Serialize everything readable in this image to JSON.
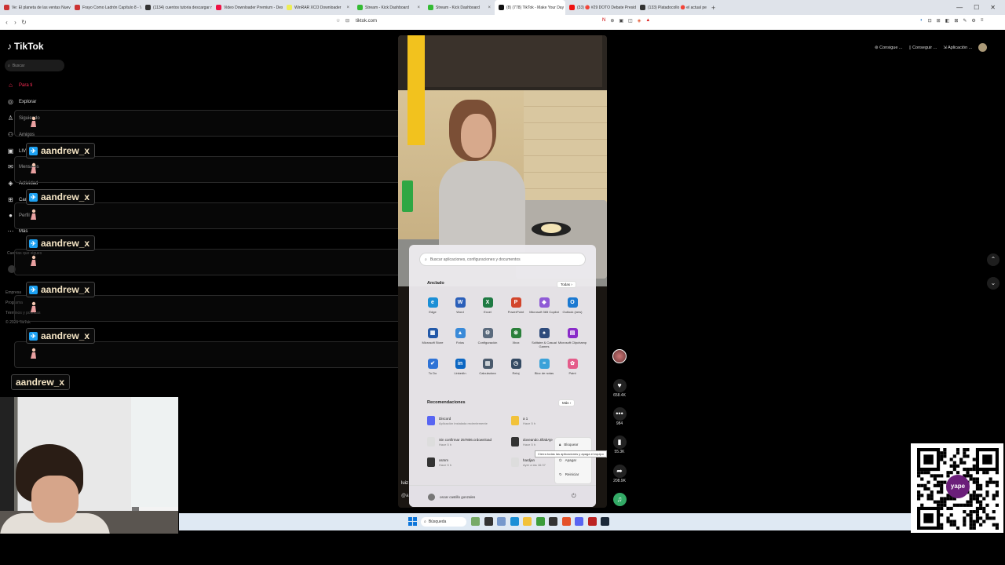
{
  "browser": {
    "tabs": [
      {
        "title": "Ve: El planeta de las ventas Nuevo...",
        "color": "#c33"
      },
      {
        "title": "Frayo Como Ladrón Capítulo 8 - Ve",
        "color": "#c33"
      },
      {
        "title": "(1134) cuentos tutoria descargar m...",
        "color": "#333"
      },
      {
        "title": "Video Downloader Premium - Descar...",
        "color": "#e14"
      },
      {
        "title": "WinRAR XCO Downloader",
        "color": "#ee5"
      },
      {
        "title": "Stream - Kick Dashboard",
        "color": "#3b3"
      },
      {
        "title": "Stream - Kick Dashboard",
        "color": "#3b3"
      },
      {
        "title": "(8) (778) TikTok - Make Your Day",
        "color": "#111",
        "active": true
      },
      {
        "title": "(33) 🔴 #29 DOTO Debate Presiden...",
        "color": "#e11"
      },
      {
        "title": "(133) Platadocollo 🔴 el actual pe...",
        "color": "#333"
      }
    ],
    "new_tab": "+",
    "url": "tiktok.com"
  },
  "tiktok": {
    "logo": "TikTok",
    "search_placeholder": "Buscar",
    "nav": [
      {
        "label": "Para ti",
        "icon": "home-icon",
        "glyph": "⌂",
        "red": true
      },
      {
        "label": "Explorar",
        "icon": "compass-icon",
        "glyph": "◎"
      },
      {
        "label": "Siguiendo",
        "icon": "user-icon",
        "glyph": "♙"
      },
      {
        "label": "Amigos",
        "icon": "friends-icon",
        "glyph": "⚇"
      },
      {
        "label": "LIVE",
        "icon": "live-icon",
        "glyph": "▣"
      },
      {
        "label": "Mensajes",
        "icon": "message-icon",
        "glyph": "✉"
      },
      {
        "label": "Actividad",
        "icon": "activity-icon",
        "glyph": "◈"
      },
      {
        "label": "Cargar",
        "icon": "upload-icon",
        "glyph": "⊞"
      },
      {
        "label": "Perfil",
        "icon": "profile-icon",
        "glyph": "●"
      },
      {
        "label": "Más",
        "icon": "more-icon",
        "glyph": "⋯"
      }
    ],
    "following_header": "Cuentas que sigues",
    "footer": [
      "Empresa",
      "Programa",
      "Términos y políticas",
      "© 2026 TikTok"
    ],
    "top_buttons": [
      "Consigue ...",
      "Conseguir ...",
      "Aplicación ..."
    ],
    "rail": {
      "likes": "658.4K",
      "comments": "984",
      "saves": "55.3K",
      "shares": "208.9K"
    },
    "video_user": "luiz",
    "video_user2": "@a"
  },
  "overlay": {
    "username": "aandrew_x"
  },
  "start_menu": {
    "search_placeholder": "Buscar aplicaciones, configuraciones y documentos",
    "pinned_title": "Anclado",
    "all_button": "Todas",
    "apps": [
      {
        "name": "Edge",
        "icon": "edge-icon",
        "color": "#1b8fd6",
        "glyph": "e"
      },
      {
        "name": "Word",
        "icon": "word-icon",
        "color": "#2b5fb9",
        "glyph": "W"
      },
      {
        "name": "Excel",
        "icon": "excel-icon",
        "color": "#1f7a43",
        "glyph": "X"
      },
      {
        "name": "PowerPoint",
        "icon": "powerpoint-icon",
        "color": "#d2452b",
        "glyph": "P"
      },
      {
        "name": "Microsoft 365 Copilot",
        "icon": "copilot-icon",
        "color": "#8f5bd6",
        "glyph": "◆"
      },
      {
        "name": "Outlook (new)",
        "icon": "outlook-icon",
        "color": "#1b79d1",
        "glyph": "O"
      },
      {
        "name": "Microsoft Store",
        "icon": "store-icon",
        "color": "#2359a8",
        "glyph": "▦"
      },
      {
        "name": "Fotos",
        "icon": "photos-icon",
        "color": "#3a8ad8",
        "glyph": "▲"
      },
      {
        "name": "Configuración",
        "icon": "settings-icon",
        "color": "#5a6a7d",
        "glyph": "⚙"
      },
      {
        "name": "Xbox",
        "icon": "xbox-icon",
        "color": "#2a7f3a",
        "glyph": "⊗"
      },
      {
        "name": "Solitaire & Casual Games",
        "icon": "solitaire-icon",
        "color": "#2e4b7c",
        "glyph": "♠"
      },
      {
        "name": "Microsoft Clipchamp",
        "icon": "clipchamp-icon",
        "color": "#8a2bc9",
        "glyph": "▤"
      },
      {
        "name": "To Do",
        "icon": "todo-icon",
        "color": "#2f73d6",
        "glyph": "✔"
      },
      {
        "name": "LinkedIn",
        "icon": "linkedin-icon",
        "color": "#0b66c2",
        "glyph": "in"
      },
      {
        "name": "Calculadora",
        "icon": "calculator-icon",
        "color": "#4a5a6c",
        "glyph": "▥"
      },
      {
        "name": "Reloj",
        "icon": "clock-icon",
        "color": "#344a63",
        "glyph": "◷"
      },
      {
        "name": "Bloc de notas",
        "icon": "notepad-icon",
        "color": "#3aa2d9",
        "glyph": "≡"
      },
      {
        "name": "Paint",
        "icon": "paint-icon",
        "color": "#e45c8a",
        "glyph": "✿"
      }
    ],
    "rec_title": "Recomendaciones",
    "more_button": "Más",
    "recommendations": [
      {
        "title": "Discord",
        "sub": "Aplicación instalada recientemente",
        "icon": "discord-icon",
        "color": "#5865f2"
      },
      {
        "title": "a 1",
        "sub": "Hace 5 h",
        "icon": "folder-icon",
        "color": "#f2c23a"
      },
      {
        "title": "Sin confirmar 257806.crdownload",
        "sub": "Hace 5 h",
        "icon": "file-icon",
        "color": "#ddd"
      },
      {
        "title": "doveando JillabAje",
        "sub": "Hace 5 h",
        "icon": "obs-icon",
        "color": "#333"
      },
      {
        "title": "xsmm",
        "sub": "Hace 5 h",
        "icon": "obs-icon",
        "color": "#333"
      },
      {
        "title": "hardjan",
        "sub": "Ayer a las 16:37",
        "icon": "file-icon",
        "color": "#ddd"
      }
    ],
    "power_menu": [
      "Bloquear",
      "Apagar",
      "Reiniciar"
    ],
    "tooltip": "Cierra todas las aplicaciones y apaga el equipo",
    "username": "oscar castillo gonzales"
  },
  "taskbar": {
    "search": "Búsqueda",
    "icons": [
      {
        "name": "widgets-icon",
        "color": "#7a6"
      },
      {
        "name": "task-view-icon",
        "color": "#333"
      },
      {
        "name": "copilot-taskbar-icon",
        "color": "#79c"
      },
      {
        "name": "edge-taskbar-icon",
        "color": "#1b8fd6"
      },
      {
        "name": "explorer-icon",
        "color": "#f2c23a"
      },
      {
        "name": "chrome-icon",
        "color": "#3b9d3b"
      },
      {
        "name": "obs-taskbar-icon",
        "color": "#333"
      },
      {
        "name": "brave-icon",
        "color": "#e4522a"
      },
      {
        "name": "discord-taskbar-icon",
        "color": "#5865f2"
      },
      {
        "name": "filezilla-icon",
        "color": "#b22"
      },
      {
        "name": "steam-icon",
        "color": "#1b2838"
      }
    ]
  },
  "qr": {
    "badge": "yape"
  }
}
